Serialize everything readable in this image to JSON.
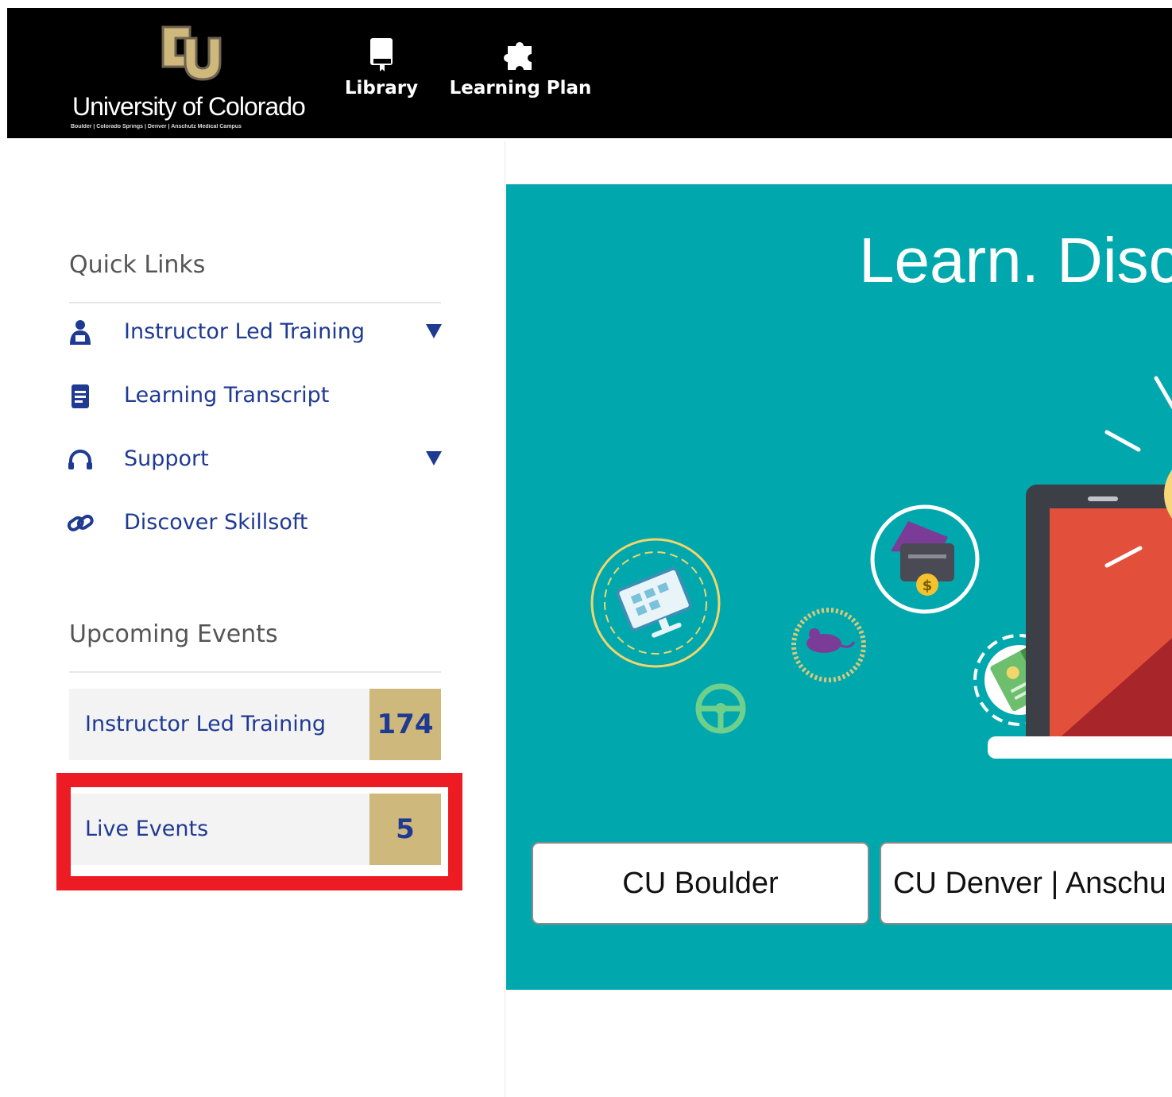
{
  "header": {
    "brand_name": "University of Colorado",
    "brand_subtitle": "Boulder | Colorado Springs | Denver | Anschutz Medical Campus",
    "nav": [
      {
        "label": "Library",
        "icon": "book-icon"
      },
      {
        "label": "Learning Plan",
        "icon": "puzzle-icon"
      }
    ]
  },
  "sidebar": {
    "quick_links_title": "Quick Links",
    "quick_links": [
      {
        "label": "Instructor Led Training",
        "icon": "instructor-icon",
        "has_dropdown": true
      },
      {
        "label": "Learning Transcript",
        "icon": "transcript-icon",
        "has_dropdown": false
      },
      {
        "label": "Support",
        "icon": "headset-icon",
        "has_dropdown": true
      },
      {
        "label": "Discover Skillsoft",
        "icon": "link-icon",
        "has_dropdown": false
      }
    ],
    "upcoming_title": "Upcoming Events",
    "events": [
      {
        "label": "Instructor Led Training",
        "count": "174"
      },
      {
        "label": "Live Events",
        "count": "5"
      }
    ]
  },
  "hero": {
    "title": "Learn. Disco",
    "campus_buttons": [
      "CU Boulder",
      "CU Denver | Anschu"
    ]
  },
  "colors": {
    "header_bg": "#000000",
    "cu_gold": "#cfb87c",
    "link_blue": "#1f3a93",
    "hero_teal": "#00a8ad",
    "highlight_red": "#ed1c24"
  }
}
